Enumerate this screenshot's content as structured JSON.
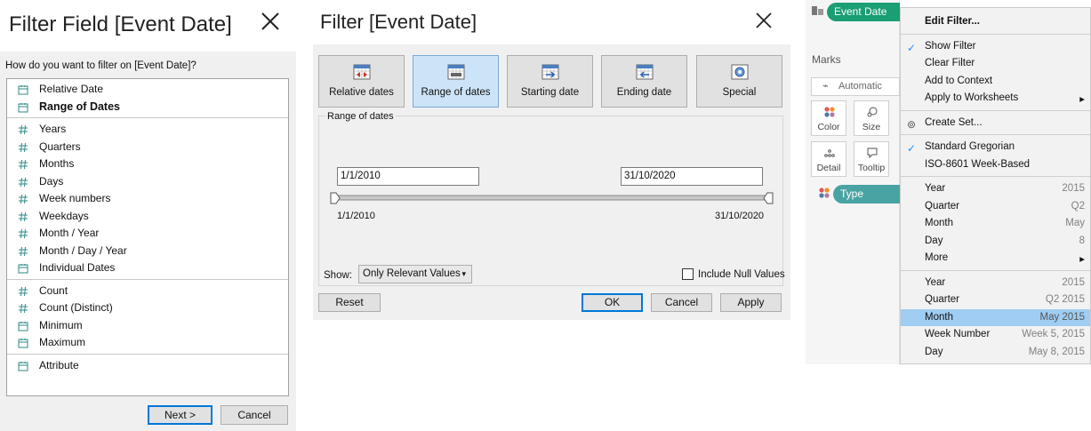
{
  "dialog1": {
    "title": "Filter Field [Event Date]",
    "question": "How do you want to filter on [Event Date]?",
    "group1": [
      {
        "label": "Relative Date",
        "icon": "calendar-icon",
        "bold": false
      },
      {
        "label": "Range of Dates",
        "icon": "calendar-icon",
        "bold": true
      }
    ],
    "group2": [
      {
        "label": "Years",
        "icon": "hash-icon"
      },
      {
        "label": "Quarters",
        "icon": "hash-icon"
      },
      {
        "label": "Months",
        "icon": "hash-icon"
      },
      {
        "label": "Days",
        "icon": "hash-icon"
      },
      {
        "label": "Week numbers",
        "icon": "hash-icon"
      },
      {
        "label": "Weekdays",
        "icon": "hash-icon"
      },
      {
        "label": "Month / Year",
        "icon": "hash-icon"
      },
      {
        "label": "Month / Day / Year",
        "icon": "hash-icon"
      },
      {
        "label": "Individual Dates",
        "icon": "calendar-icon"
      }
    ],
    "group3": [
      {
        "label": "Count",
        "icon": "hash-icon"
      },
      {
        "label": "Count (Distinct)",
        "icon": "hash-icon"
      },
      {
        "label": "Minimum",
        "icon": "calendar-icon"
      },
      {
        "label": "Maximum",
        "icon": "calendar-icon"
      }
    ],
    "group4": [
      {
        "label": "Attribute",
        "icon": "calendar-icon"
      }
    ],
    "next_label": "Next >",
    "cancel_label": "Cancel"
  },
  "dialog2": {
    "title": "Filter [Event Date]",
    "tabs": [
      {
        "label": "Relative dates",
        "icon": "calendar-arrows-icon",
        "selected": false
      },
      {
        "label": "Range of dates",
        "icon": "calendar-range-icon",
        "selected": true
      },
      {
        "label": "Starting date",
        "icon": "calendar-start-icon",
        "selected": false
      },
      {
        "label": "Ending date",
        "icon": "calendar-end-icon",
        "selected": false
      },
      {
        "label": "Special",
        "icon": "special-icon",
        "selected": false
      }
    ],
    "group_label": "Range of dates",
    "start_value": "1/1/2010",
    "end_value": "31/10/2020",
    "slider_min_label": "1/1/2010",
    "slider_max_label": "31/10/2020",
    "show_label": "Show:",
    "show_value": "Only Relevant Values",
    "include_null_label": "Include Null Values",
    "include_null_checked": false,
    "reset_label": "Reset",
    "ok_label": "OK",
    "cancel_label": "Cancel",
    "apply_label": "Apply"
  },
  "panel3": {
    "filter_pill": "Event Date",
    "marks_title": "Marks",
    "mark_type": "Automatic",
    "mark_cards": [
      "Color",
      "Size",
      "Detail",
      "Tooltip"
    ],
    "type_pill": "Type",
    "pill_color": "#1a9e74",
    "type_pill_color": "#4aa3a3",
    "menu": {
      "edit_filter": "Edit Filter...",
      "section1": [
        {
          "label": "Show Filter",
          "checked": true
        },
        {
          "label": "Clear Filter",
          "checked": false
        },
        {
          "label": "Add to Context",
          "checked": false
        },
        {
          "label": "Apply to Worksheets",
          "submenu": true
        }
      ],
      "create_set": "Create Set...",
      "section3": [
        {
          "label": "Standard Gregorian",
          "checked": true
        },
        {
          "label": "ISO-8601 Week-Based",
          "checked": false
        }
      ],
      "date_parts": [
        {
          "label": "Year",
          "value": "2015"
        },
        {
          "label": "Quarter",
          "value": "Q2"
        },
        {
          "label": "Month",
          "value": "May"
        },
        {
          "label": "Day",
          "value": "8"
        },
        {
          "label": "More",
          "value": "",
          "submenu": true
        }
      ],
      "date_values": [
        {
          "label": "Year",
          "value": "2015",
          "highlighted": false
        },
        {
          "label": "Quarter",
          "value": "Q2 2015",
          "highlighted": false
        },
        {
          "label": "Month",
          "value": "May 2015",
          "highlighted": true
        },
        {
          "label": "Week Number",
          "value": "Week 5, 2015",
          "highlighted": false
        },
        {
          "label": "Day",
          "value": "May 8, 2015",
          "highlighted": false
        }
      ]
    }
  }
}
